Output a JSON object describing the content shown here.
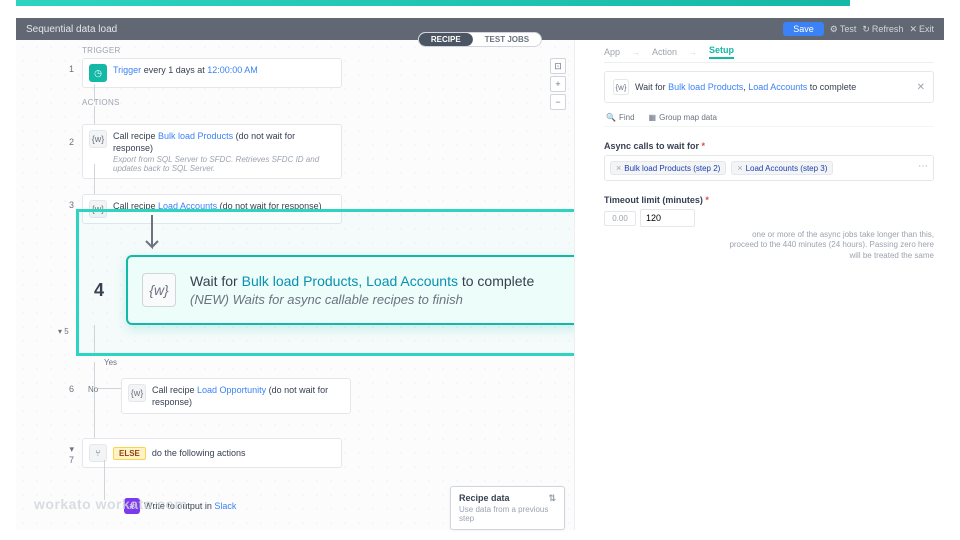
{
  "header": {
    "title": "Sequential data load",
    "save": "Save",
    "test": "Test",
    "refresh": "Refresh",
    "exit": "Exit"
  },
  "tabs": {
    "recipe": "RECIPE",
    "testjobs": "TEST JOBS"
  },
  "sections": {
    "trigger": "TRIGGER",
    "actions": "ACTIONS"
  },
  "steps": {
    "s1": {
      "prefix": "Trigger",
      "mid": " every 1 days at ",
      "time": "12:00:00 AM"
    },
    "s2": {
      "title_a": "Call recipe ",
      "title_b": "Bulk load Products",
      "title_c": " (do not wait for response)",
      "desc": "Export from SQL Server to SFDC. Retrieves SFDC ID and updates back to SQL Server."
    },
    "s3": {
      "title_a": "Call recipe ",
      "title_b": "Load Accounts",
      "title_c": " (do not wait for response)"
    },
    "s4": {
      "main_a": "Wait for ",
      "main_b": "Bulk load Products, Load Accounts",
      "main_c": " to complete",
      "desc": "(NEW) Waits for async callable recipes to finish"
    },
    "s6": {
      "title_a": "Call recipe ",
      "title_b": "Load Opportunity",
      "title_c": " (do not wait for response)"
    },
    "s7": {
      "else": "ELSE",
      "text": "do the following actions"
    },
    "foot": {
      "pre": "Write",
      "mid": " to output in ",
      "link": "Slack"
    }
  },
  "labels": {
    "yes": "Yes",
    "no": "No"
  },
  "panel": {
    "tabs": {
      "app": "App",
      "action": "Action",
      "setup": "Setup"
    },
    "crumb": {
      "a": "Wait for ",
      "b": "Bulk load Products",
      "comma": ", ",
      "c": "Load Accounts",
      "d": " to complete"
    },
    "find": "Find",
    "groupmap": "Group map data",
    "field1_label": "Async calls to wait for",
    "chip1": "Bulk load Products (step 2)",
    "chip2": "Load Accounts (step 3)",
    "field2_label": "Timeout limit (minutes)",
    "timeout_min": "0.00",
    "timeout_val": "120",
    "help": "one or more of the async jobs take longer than this, proceed to the 440 minutes (24 hours). Passing zero here will be treated the same"
  },
  "recipe_data": {
    "title": "Recipe data",
    "desc": "Use data from a previous step"
  },
  "watermark": "workato workato.com"
}
